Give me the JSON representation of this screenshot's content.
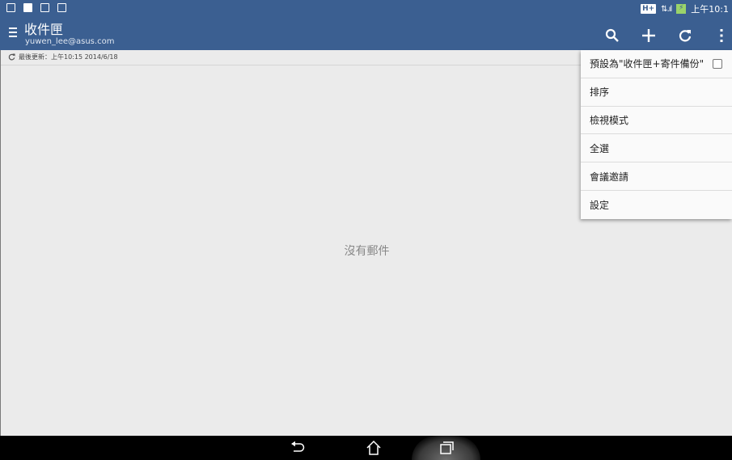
{
  "status_bar": {
    "time": "上午10:1",
    "network_badge": "H+",
    "icons": [
      "calendar-icon",
      "file-icon",
      "edit-icon",
      "mail-icon"
    ]
  },
  "app_bar": {
    "title": "收件匣",
    "account": "yuwen_lee@asus.com",
    "actions": [
      "search-icon",
      "add-icon",
      "refresh-icon",
      "overflow-icon"
    ],
    "color": "#3b5f91"
  },
  "content": {
    "last_update": "最後更新：上午10:15 2014/6/18",
    "empty_message": "沒有郵件"
  },
  "menu": {
    "items": [
      {
        "label": "預設為\"收件匣+寄件備份\"",
        "checked": false
      },
      {
        "label": "排序"
      },
      {
        "label": "檢視模式"
      },
      {
        "label": "全選"
      },
      {
        "label": "會議邀請"
      },
      {
        "label": "設定"
      }
    ]
  },
  "nav_bar": {
    "buttons": [
      "back-icon",
      "home-icon",
      "recent-apps-icon"
    ]
  }
}
